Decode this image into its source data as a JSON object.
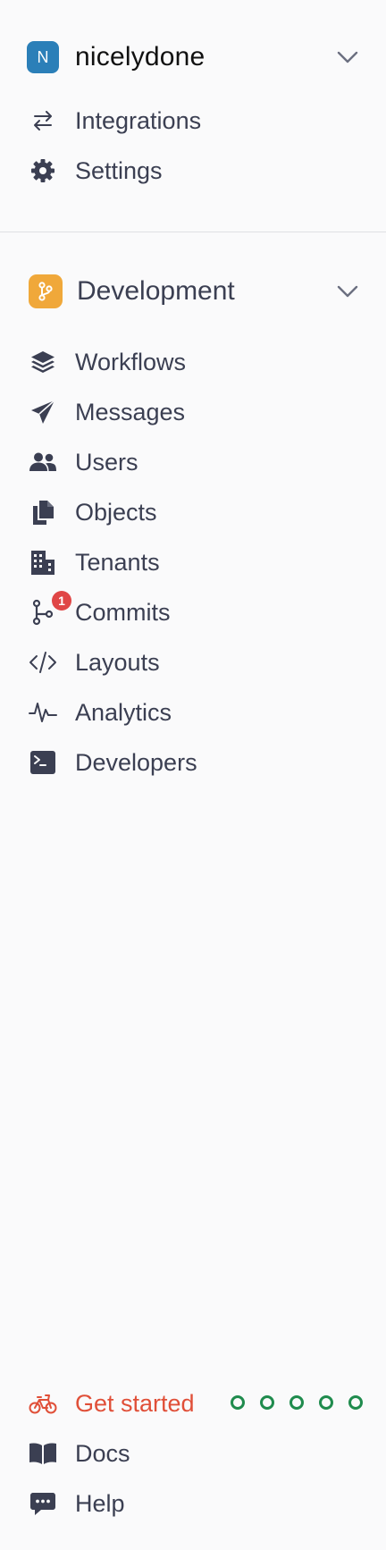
{
  "workspace": {
    "initial": "N",
    "name": "nicelydone"
  },
  "workspace_nav": [
    {
      "label": "Integrations",
      "icon": "arrows-swap-icon"
    },
    {
      "label": "Settings",
      "icon": "gear-icon"
    }
  ],
  "environment": {
    "name": "Development",
    "icon": "git-branch-icon"
  },
  "env_nav": [
    {
      "label": "Workflows",
      "icon": "layers-icon"
    },
    {
      "label": "Messages",
      "icon": "paper-plane-icon"
    },
    {
      "label": "Users",
      "icon": "users-icon"
    },
    {
      "label": "Objects",
      "icon": "documents-icon"
    },
    {
      "label": "Tenants",
      "icon": "building-icon"
    },
    {
      "label": "Commits",
      "icon": "git-commit-icon",
      "badge": "1"
    },
    {
      "label": "Layouts",
      "icon": "code-icon"
    },
    {
      "label": "Analytics",
      "icon": "pulse-icon"
    },
    {
      "label": "Developers",
      "icon": "terminal-icon"
    }
  ],
  "footer": {
    "get_started": {
      "label": "Get started",
      "icon": "bicycle-icon",
      "steps_total": 5,
      "steps_completed": 0
    },
    "docs": {
      "label": "Docs",
      "icon": "book-icon"
    },
    "help": {
      "label": "Help",
      "icon": "chat-bubble-icon"
    }
  },
  "colors": {
    "workspace_avatar": "#2b7fb8",
    "environment_badge": "#f0a83a",
    "notification": "#e04646",
    "get_started": "#e04f38",
    "progress_step": "#1f8b4d",
    "text": "#3b3f52"
  }
}
